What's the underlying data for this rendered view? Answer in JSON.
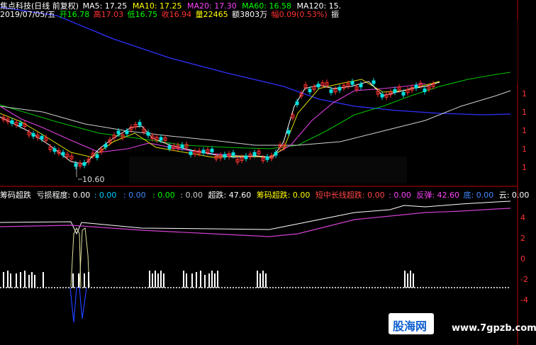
{
  "chart_title": {
    "name": "焦点科技(日线 前复权)",
    "ma5": "MA5: 17.25",
    "ma10": "MA10: 17.25",
    "ma20": "MA20: 17.30",
    "ma60": "MA60: 16.58",
    "ma120": "MA120: 15."
  },
  "quote": {
    "date": "2019/07/05/五",
    "open": "开16.78",
    "high": "高17.03",
    "low": "低16.75",
    "close": "收16.94",
    "vol": "量22465",
    "amt": "额3803万",
    "chg": "幅0.09(0.53%)",
    "amp": "振"
  },
  "low_marker": "10.60",
  "indicator": {
    "name": "筹码超跌",
    "loss": "亏损程度: 0.00",
    "v1": ": 0.00",
    "v2": ": 0.00",
    "v3": ": 0.00",
    "v4": ": 0.00",
    "chaodie": "超跌: 47.60",
    "chouma": "筹码超跌: 0.00",
    "dzcx": "短中长线超跌: 0.00",
    "v5": ": 0.00",
    "fantan": "反弹: 42.60",
    "di": "底: 0.00",
    "yun": "云: 0.00"
  },
  "right_axis": {
    "main": [
      "1",
      "1",
      "1",
      "1",
      "1"
    ],
    "sub": [
      "4",
      "2",
      "0",
      "-2",
      "-4"
    ]
  },
  "watermark": {
    "logo": "股海网",
    "url": "www.7gpzb.com"
  },
  "colors": {
    "ma5": "#ffffff",
    "ma10": "#ffff00",
    "ma20": "#ff44ff",
    "ma60": "#00ff00",
    "ma120": "#4040ff",
    "axis": "#c00000"
  }
}
